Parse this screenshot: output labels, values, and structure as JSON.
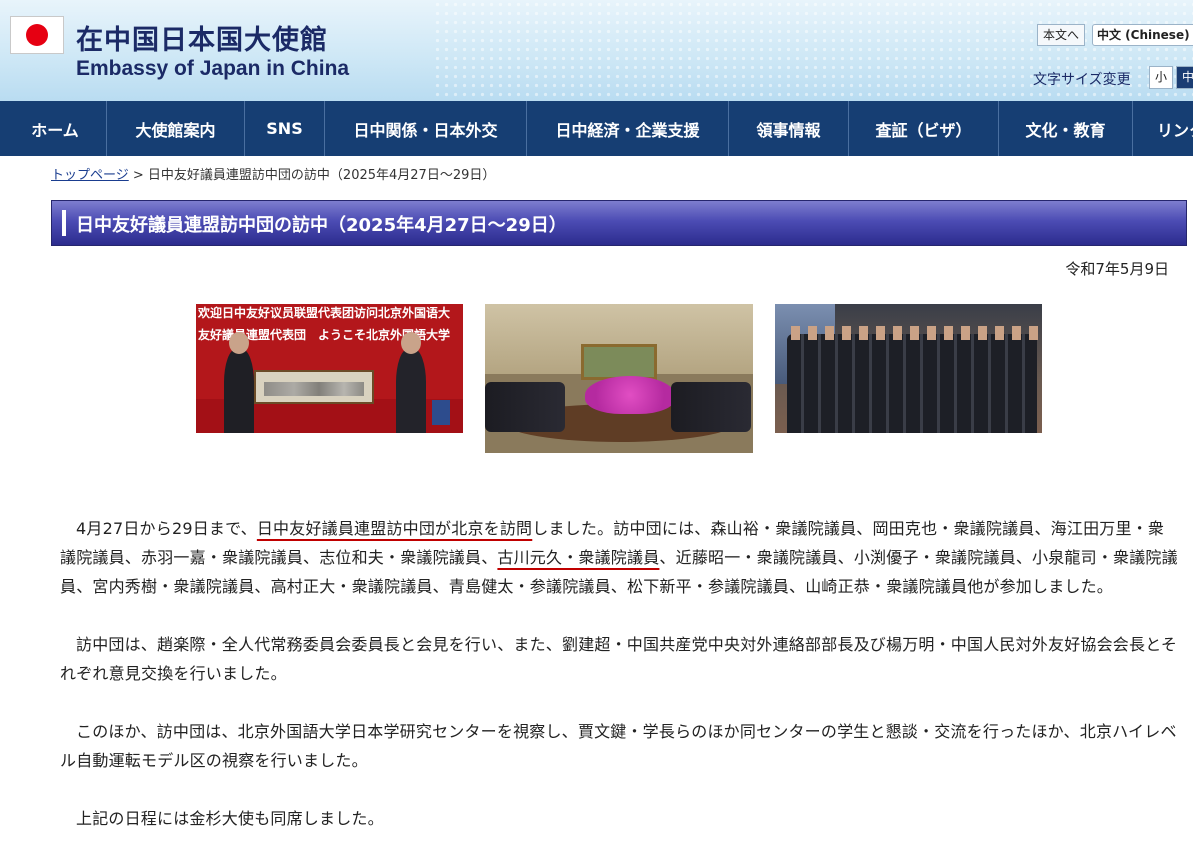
{
  "header": {
    "title_ja": "在中国日本国大使館",
    "title_en": "Embassy of Japan in China",
    "lang_ja": "本文へ",
    "lang_zh": "中文 (Chinese)",
    "font_size_label": "文字サイズ変更",
    "font_small": "小",
    "font_mid": "中"
  },
  "nav": {
    "items": [
      {
        "label": "ホーム"
      },
      {
        "label": "大使館案内"
      },
      {
        "label": "SNS"
      },
      {
        "label": "日中関係・日本外交"
      },
      {
        "label": "日中経済・企業支援"
      },
      {
        "label": "領事情報"
      },
      {
        "label": "査証（ビザ）"
      },
      {
        "label": "文化・教育"
      },
      {
        "label": "リンク"
      }
    ]
  },
  "breadcrumb": {
    "home": "トップページ",
    "separator": " > ",
    "current": "日中友好議員連盟訪中団の訪中（2025年4月27日～29日）"
  },
  "page": {
    "title": "日中友好議員連盟訪中団の訪中（2025年4月27日～29日）",
    "date": "令和7年5月9日"
  },
  "photos": {
    "photo1_banner1": "欢迎日中友好议员联盟代表团访问北京外国语大",
    "photo1_banner2": "友好議員連盟代表団　ようこそ北京外国語大学"
  },
  "body": {
    "p1_pre": "4月27日から29日まで、",
    "p1_u1": "日中友好議員連盟訪中団が北京を訪問",
    "p1_mid": "しました。訪中団には、森山裕・衆議院議員、岡田克也・衆議院議員、海江田万里・衆議院議員、赤羽一嘉・衆議院議員、志位和夫・衆議院議員、",
    "p1_u2": "古川元久・衆議院議員",
    "p1_post": "、近藤昭一・衆議院議員、小渕優子・衆議院議員、小泉龍司・衆議院議員、宮内秀樹・衆議院議員、高村正大・衆議院議員、青島健太・参議院議員、松下新平・参議院議員、山崎正恭・衆議院議員他が参加しました。",
    "p2": "訪中団は、趙楽際・全人代常務委員会委員長と会見を行い、また、劉建超・中国共産党中央対外連絡部部長及び楊万明・中国人民対外友好協会会長とそれぞれ意見交換を行いました。",
    "p3": "このほか、訪中団は、北京外国語大学日本学研究センターを視察し、賈文鍵・学長らのほか同センターの学生と懇談・交流を行ったほか、北京ハイレベル自動運転モデル区の視察を行いました。",
    "p4": "上記の日程には金杉大使も同席しました。"
  }
}
